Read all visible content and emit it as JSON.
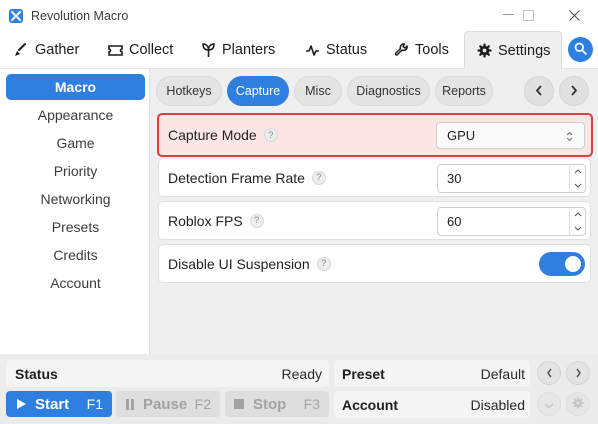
{
  "window": {
    "title": "Revolution Macro"
  },
  "nav": {
    "tabs": [
      {
        "label": "Gather",
        "icon": "broom-icon"
      },
      {
        "label": "Collect",
        "icon": "ticket-icon"
      },
      {
        "label": "Planters",
        "icon": "sprout-icon"
      },
      {
        "label": "Status",
        "icon": "pulse-icon"
      },
      {
        "label": "Tools",
        "icon": "wrench-icon"
      },
      {
        "label": "Settings",
        "icon": "gear-icon"
      }
    ],
    "active": "Settings"
  },
  "sidebar": {
    "items": [
      "Macro",
      "Appearance",
      "Game",
      "Priority",
      "Networking",
      "Presets",
      "Credits",
      "Account"
    ],
    "active": "Macro"
  },
  "subtabs": {
    "items": [
      "Hotkeys",
      "Capture",
      "Misc",
      "Diagnostics",
      "Reports"
    ],
    "active": "Capture"
  },
  "settings": {
    "capture_mode": {
      "label": "Capture Mode",
      "help": "?",
      "value": "GPU"
    },
    "detection_frame_rate": {
      "label": "Detection Frame Rate",
      "help": "?",
      "value": "30"
    },
    "roblox_fps": {
      "label": "Roblox FPS",
      "help": "?",
      "value": "60"
    },
    "disable_ui_suspension": {
      "label": "Disable UI Suspension",
      "help": "?",
      "enabled": true
    }
  },
  "status_bar": {
    "status_label": "Status",
    "status_value": "Ready",
    "preset_label": "Preset",
    "preset_value": "Default",
    "account_label": "Account",
    "account_value": "Disabled",
    "start": {
      "label": "Start",
      "key": "F1"
    },
    "pause": {
      "label": "Pause",
      "key": "F2"
    },
    "stop": {
      "label": "Stop",
      "key": "F3"
    }
  },
  "colors": {
    "accent": "#2f7fe0",
    "highlight_border": "#d94040",
    "highlight_bg": "#fbe5e5"
  }
}
